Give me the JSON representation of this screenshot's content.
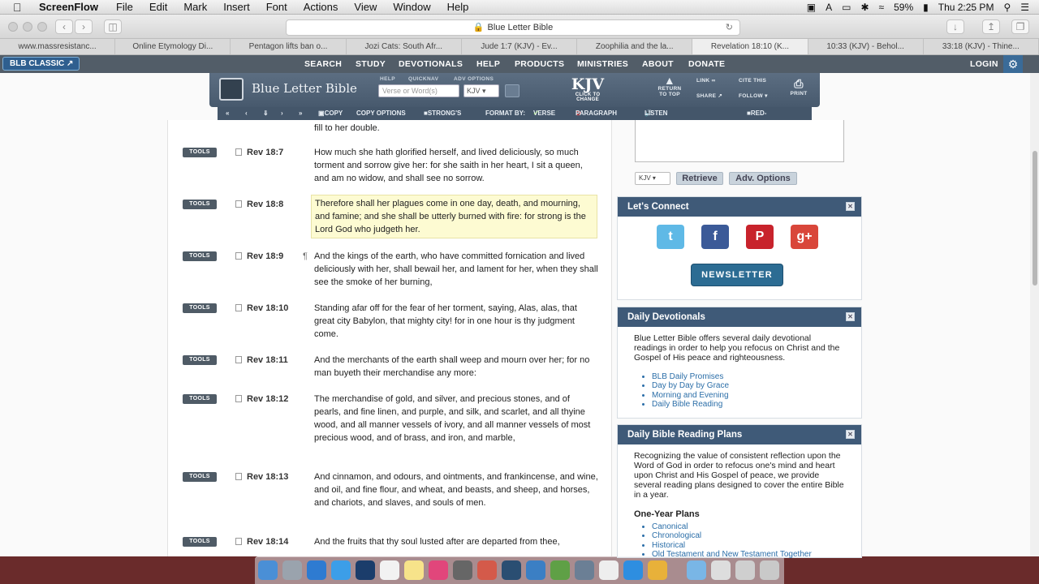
{
  "menubar": {
    "app_name": "ScreenFlow",
    "items": [
      "File",
      "Edit",
      "Mark",
      "Insert",
      "Font",
      "Actions",
      "View",
      "Window",
      "Help"
    ],
    "battery": "59%",
    "clock": "Thu 2:25 PM"
  },
  "browser": {
    "url": "Blue Letter Bible",
    "tabs": [
      "www.massresistanc...",
      "Online Etymology Di...",
      "Pentagon lifts ban o...",
      "Jozi Cats: South Afr...",
      "Jude 1:7 (KJV) - Ev...",
      "Zoophilia and the la...",
      "Revelation 18:10 (K...",
      "10:33 (KJV) - Behol...",
      "33:18 (KJV) - Thine..."
    ]
  },
  "site_nav": {
    "classic_label": "BLB CLASSIC",
    "items": [
      "SEARCH",
      "STUDY",
      "DEVOTIONALS",
      "HELP",
      "PRODUCTS",
      "MINISTRIES",
      "ABOUT",
      "DONATE"
    ],
    "login": "LOGIN"
  },
  "header": {
    "logo_text": "Blue Letter Bible",
    "labels": {
      "help": "HELP",
      "quicknav": "QUICKNAV",
      "adv": "ADV OPTIONS"
    },
    "verse_placeholder": "Verse or Word(s)",
    "version": "KJV",
    "kjv_big": "KJV",
    "kjv_small": "CLICK TO CHANGE",
    "return_top": "RETURN TO TOP",
    "link": "LINK",
    "share": "SHARE",
    "cite": "CITE THIS",
    "follow": "FOLLOW",
    "print": "PRINT"
  },
  "toolbar": {
    "copy": "COPY",
    "copy_options": "COPY OPTIONS",
    "strongs": "STRONG'S",
    "format_by": "FORMAT BY:",
    "verse": "VERSE",
    "paragraph": "PARAGRAPH",
    "listen": "LISTEN TO THE BIBLE",
    "red_letter": "RED-LETTER"
  },
  "verses": {
    "tools_label": "TOOLS",
    "partial": "fill to her double.",
    "items": [
      {
        "ref": "Rev 18:7",
        "text": "How much she hath glorified herself, and lived deliciously, so much torment and sorrow give her: for she saith in her heart, I sit a queen, and am no widow, and shall see no sorrow."
      },
      {
        "ref": "Rev 18:8",
        "text": "Therefore shall her plagues come in one day, death, and mourning, and famine; and she shall be utterly burned with fire: for strong is the Lord God who judgeth her."
      },
      {
        "ref": "Rev 18:9",
        "text": "And the kings of the earth, who have committed fornication and lived deliciously with her, shall bewail her, and lament for her, when they shall see the smoke of her burning,"
      },
      {
        "ref": "Rev 18:10",
        "text": "Standing afar off for the fear of her torment, saying, Alas, alas, that great city Babylon, that mighty city! for in one hour is thy judgment come."
      },
      {
        "ref": "Rev 18:11",
        "text": "And the merchants of the earth shall weep and mourn over her; for no man buyeth their merchandise any more:"
      },
      {
        "ref": "Rev 18:12",
        "text": "The merchandise of gold, and silver, and precious stones, and of pearls, and fine linen, and purple, and silk, and scarlet, and all thyine wood, and all manner vessels of ivory, and all manner vessels of most precious wood, and of brass, and iron, and marble,"
      },
      {
        "ref": "Rev 18:13",
        "text": "And cinnamon, and odours, and ointments, and frankincense, and wine, and oil, and fine flour, and wheat, and beasts, and sheep, and horses, and chariots, and slaves, and souls of men."
      },
      {
        "ref": "Rev 18:14",
        "text": "And the fruits that thy soul lusted after are departed from thee,"
      }
    ]
  },
  "sidebar": {
    "version": "KJV",
    "retrieve": "Retrieve",
    "adv_options": "Adv. Options",
    "connect": {
      "title": "Let's Connect",
      "newsletter": "NEWSLETTER"
    },
    "devotionals": {
      "title": "Daily Devotionals",
      "body": "Blue Letter Bible offers several daily devotional readings in order to help you refocus on Christ and the Gospel of His peace and righteousness.",
      "links": [
        "BLB Daily Promises",
        "Day by Day by Grace",
        "Morning and Evening",
        "Daily Bible Reading"
      ]
    },
    "reading_plans": {
      "title": "Daily Bible Reading Plans",
      "body": "Recognizing the value of consistent reflection upon the Word of God in order to refocus one's mind and heart upon Christ and His Gospel of peace, we provide several reading plans designed to cover the entire Bible in a year.",
      "subtitle": "One-Year Plans",
      "links": [
        "Canonical",
        "Chronological",
        "Historical",
        "Old Testament and New Testament Together"
      ]
    }
  },
  "colors": {
    "nav_bg": "#525d68",
    "panel_head": "#3f5a78",
    "highlight": "#fdfbd2",
    "link": "#2b6ea8"
  }
}
